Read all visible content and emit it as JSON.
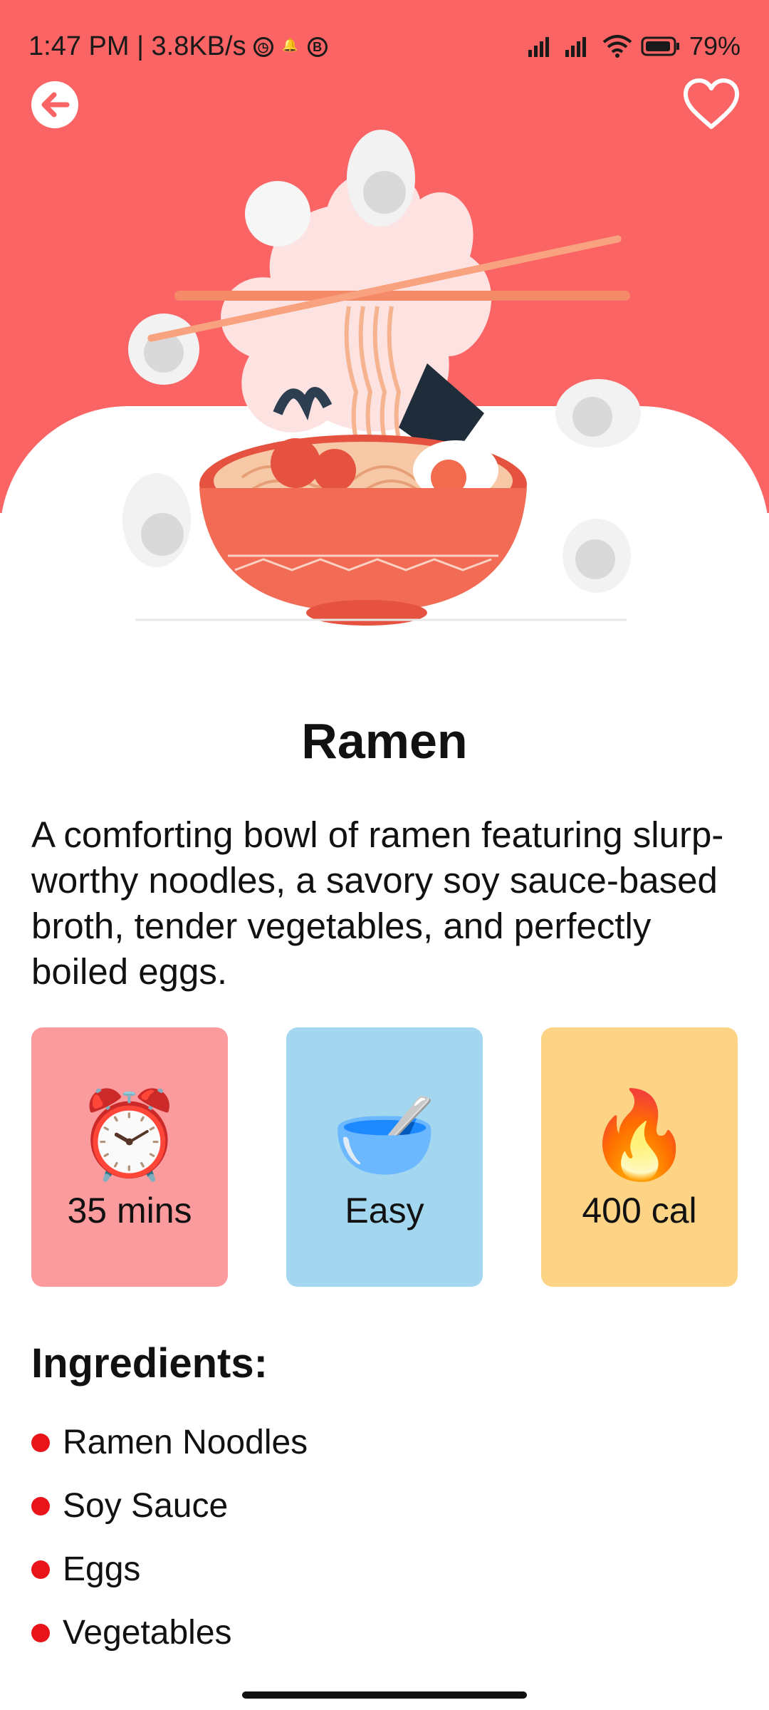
{
  "status_bar": {
    "time_speed": "1:47 PM | 3.8KB/s",
    "battery": "79%"
  },
  "header": {
    "back_icon": "arrow-left-icon",
    "favorite_icon": "heart-outline-icon"
  },
  "recipe": {
    "name": "Ramen",
    "description": "A comforting bowl of ramen featuring slurp-worthy noodles, a savory soy sauce-based broth, tender vegetables, and perfectly boiled eggs.",
    "stats": [
      {
        "icon": "alarm-clock-icon",
        "emoji": "⏰",
        "label": "35 mins",
        "color": "#fc9b9d"
      },
      {
        "icon": "bowl-with-spoon-icon",
        "emoji": "🥣",
        "label": "Easy",
        "color": "#a2d7ef"
      },
      {
        "icon": "fire-icon",
        "emoji": "🔥",
        "label": "400 cal",
        "color": "#fdd386"
      }
    ],
    "ingredients_title": "Ingredients:",
    "ingredients": [
      "Ramen Noodles",
      "Soy Sauce",
      "Eggs",
      "Vegetables"
    ]
  },
  "colors": {
    "hero_bg": "#fb6464",
    "bullet": "#e8141a"
  }
}
